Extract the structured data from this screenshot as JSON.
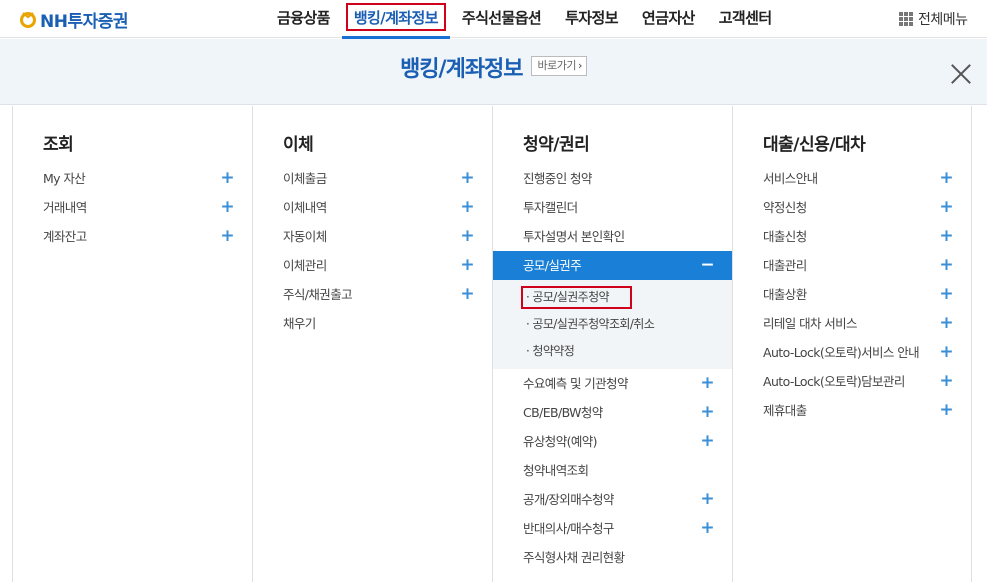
{
  "header": {
    "logo_text": "NH투자증권",
    "nav": [
      {
        "label": "금융상품",
        "active": false
      },
      {
        "label": "뱅킹/계좌정보",
        "active": true
      },
      {
        "label": "주식선물옵션",
        "active": false
      },
      {
        "label": "투자정보",
        "active": false
      },
      {
        "label": "연금자산",
        "active": false
      },
      {
        "label": "고객센터",
        "active": false
      }
    ],
    "all_menu_label": "전체메뉴",
    "all_menu_icon": "grid-icon"
  },
  "section": {
    "title": "뱅킹/계좌정보",
    "goto_label": "바로가기",
    "close_icon": "close-icon"
  },
  "columns": [
    {
      "title": "조회",
      "items": [
        {
          "label": "My 자산",
          "expandable": true
        },
        {
          "label": "거래내역",
          "expandable": true
        },
        {
          "label": "계좌잔고",
          "expandable": true
        }
      ]
    },
    {
      "title": "이체",
      "items": [
        {
          "label": "이체출금",
          "expandable": true
        },
        {
          "label": "이체내역",
          "expandable": true
        },
        {
          "label": "자동이체",
          "expandable": true
        },
        {
          "label": "이체관리",
          "expandable": true
        },
        {
          "label": "주식/채권출고",
          "expandable": true
        },
        {
          "label": "채우기",
          "expandable": false
        }
      ]
    },
    {
      "title": "청약/권리",
      "items": [
        {
          "label": "진행중인 청약",
          "expandable": false
        },
        {
          "label": "투자캘린더",
          "expandable": false
        },
        {
          "label": "투자설명서 본인확인",
          "expandable": false
        },
        {
          "label": "공모/실권주",
          "expandable": true,
          "open": true,
          "toggle": "−",
          "children": [
            "· 공모/실권주청약",
            "· 공모/실권주청약조회/취소",
            "· 청약약정"
          ]
        },
        {
          "label": "수요예측 및 기관청약",
          "expandable": true
        },
        {
          "label": "CB/EB/BW청약",
          "expandable": true
        },
        {
          "label": "유상청약(예약)",
          "expandable": true
        },
        {
          "label": "청약내역조회",
          "expandable": false
        },
        {
          "label": "공개/장외매수청약",
          "expandable": true
        },
        {
          "label": "반대의사/매수청구",
          "expandable": true
        },
        {
          "label": "주식형사채 권리현황",
          "expandable": false
        }
      ]
    },
    {
      "title": "대출/신용/대차",
      "items": [
        {
          "label": "서비스안내",
          "expandable": true
        },
        {
          "label": "약정신청",
          "expandable": true
        },
        {
          "label": "대출신청",
          "expandable": true
        },
        {
          "label": "대출관리",
          "expandable": true
        },
        {
          "label": "대출상환",
          "expandable": true
        },
        {
          "label": "리테일 대차 서비스",
          "expandable": true
        },
        {
          "label": "Auto-Lock(오토락)서비스 안내",
          "expandable": true
        },
        {
          "label": "Auto-Lock(오토락)담보관리",
          "expandable": true
        },
        {
          "label": "제휴대출",
          "expandable": true
        }
      ]
    }
  ],
  "plus_symbol": "+",
  "colors": {
    "brand": "#1a5fb4",
    "accent": "#1a7fd6",
    "highlight": "#d0021b",
    "logo_gold": "#e8a400"
  }
}
